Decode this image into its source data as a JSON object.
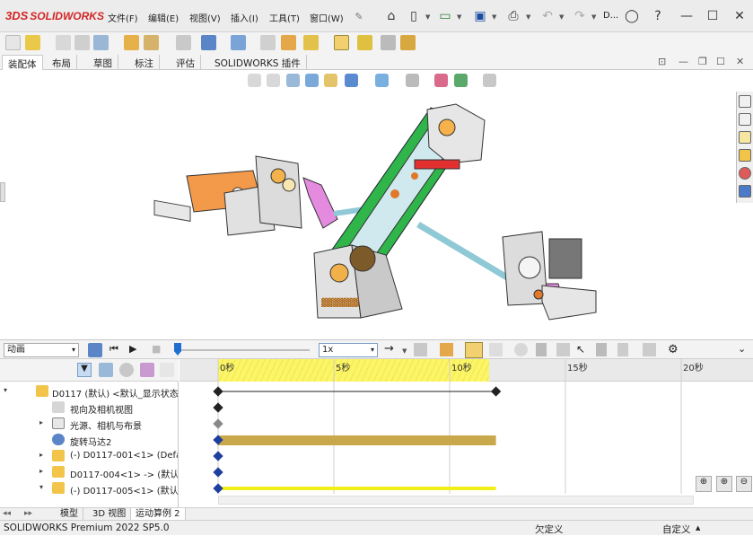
{
  "app": {
    "brand": "SOLIDWORKS",
    "brand_prefix": "3DS",
    "truncated_doc": "D..."
  },
  "menu": [
    "文件(F)",
    "编辑(E)",
    "视图(V)",
    "插入(I)",
    "工具(T)",
    "窗口(W)"
  ],
  "tabs": [
    "装配体",
    "布局",
    "草图",
    "标注",
    "评估",
    "SOLIDWORKS 插件"
  ],
  "active_tab_index": 0,
  "motion": {
    "study_type": "动画",
    "speed": "1x"
  },
  "timeline": {
    "ticks": [
      {
        "t": 0,
        "label": "0秒"
      },
      {
        "t": 5,
        "label": "5秒"
      },
      {
        "t": 10,
        "label": "10秒"
      },
      {
        "t": 15,
        "label": "15秒"
      },
      {
        "t": 20,
        "label": "20秒"
      }
    ],
    "duration_s": 12
  },
  "tree": {
    "rows": [
      {
        "expand": "▾",
        "icon": "assembly-icon",
        "text": "D0117 (默认) <默认_显示状态",
        "indent": 0
      },
      {
        "expand": "",
        "icon": "camera-icon",
        "text": "视向及相机视图",
        "indent": 1
      },
      {
        "expand": "▸",
        "icon": "lights-icon",
        "text": "光源、相机与布景",
        "indent": 1
      },
      {
        "expand": "",
        "icon": "motor-icon",
        "text": "旋转马达2",
        "indent": 1
      },
      {
        "expand": "▸",
        "icon": "part-icon",
        "text": "(-) D0117-001<1> (Defa",
        "indent": 1
      },
      {
        "expand": "▸",
        "icon": "part-icon",
        "text": "D0117-004<1> -> (默认)",
        "indent": 1
      },
      {
        "expand": "▾",
        "icon": "part-icon",
        "text": "(-) D0117-005<1> (默认)",
        "indent": 1
      }
    ]
  },
  "bottom_tabs": [
    "模型",
    "3D 视图",
    "运动算例 2"
  ],
  "active_bottom_tab_index": 2,
  "status": {
    "product": "SOLIDWORKS Premium 2022 SP5.0",
    "undefined_label": "欠定义",
    "custom_label": "自定义"
  },
  "colors": {
    "brand_red": "#d42424",
    "key_blue": "#1f3f9f",
    "motor_bar": "#c9a84c",
    "yellow_bar": "#f1ef1a",
    "hatch_yellow": "#f8ee4c"
  }
}
